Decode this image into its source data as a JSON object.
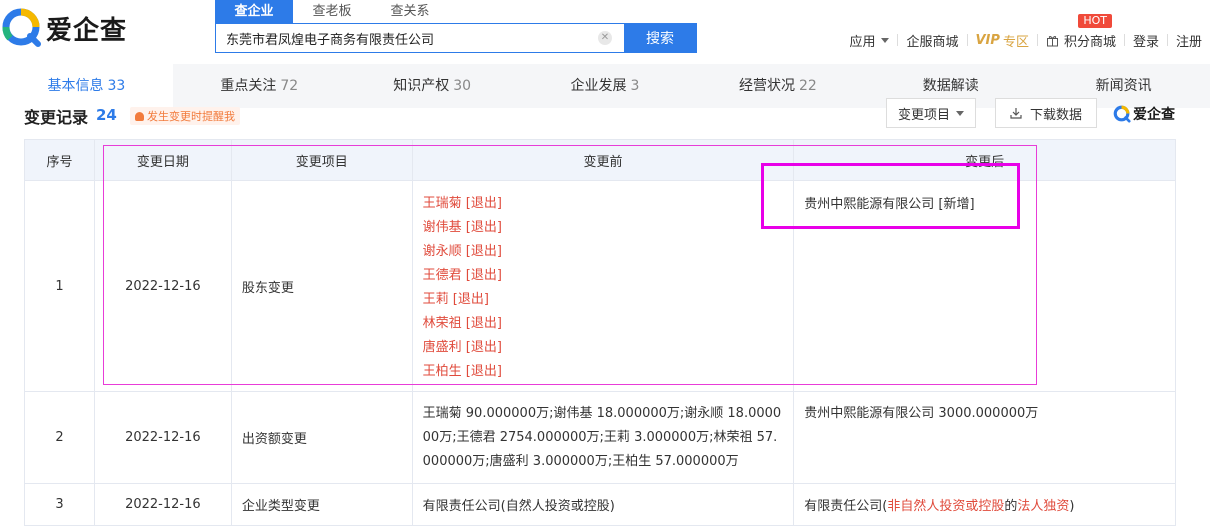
{
  "header": {
    "logo_text": "爱企查",
    "search_tabs": [
      "查企业",
      "查老板",
      "查关系"
    ],
    "search_value": "东莞市君凤煌电子商务有限责任公司",
    "search_button": "搜索",
    "nav": {
      "apps": "应用",
      "enterprise_mall": "企服商城",
      "vip_v": "VIP",
      "vip_rest": "专区",
      "points_mall": "积分商城",
      "hot_badge": "HOT",
      "login": "登录",
      "register": "注册"
    }
  },
  "tabs": [
    {
      "label": "基本信息",
      "count": "33"
    },
    {
      "label": "重点关注",
      "count": "72"
    },
    {
      "label": "知识产权",
      "count": "30"
    },
    {
      "label": "企业发展",
      "count": "3"
    },
    {
      "label": "经营状况",
      "count": "22"
    },
    {
      "label": "数据解读",
      "count": ""
    },
    {
      "label": "新闻资讯",
      "count": ""
    }
  ],
  "section": {
    "title": "变更记录",
    "count": "24",
    "remind": "发生变更时提醒我",
    "change_select": "变更项目",
    "download": "下载数据",
    "mini_logo": "爱企查"
  },
  "table": {
    "headers": [
      "序号",
      "变更日期",
      "变更项目",
      "变更前",
      "变更后"
    ],
    "rows": [
      {
        "idx": "1",
        "date": "2022-12-16",
        "item": "股东变更",
        "before": [
          "王瑞菊 [退出]",
          "谢伟基 [退出]",
          "谢永顺 [退出]",
          "王德君 [退出]",
          "王莉 [退出]",
          "林荣祖 [退出]",
          "唐盛利 [退出]",
          "王柏生 [退出]"
        ],
        "after": "贵州中熙能源有限公司 [新增]"
      },
      {
        "idx": "2",
        "date": "2022-12-16",
        "item": "出资额变更",
        "before": "王瑞菊 90.000000万;谢伟基 18.000000万;谢永顺 18.000000万;王德君 2754.000000万;王莉 3.000000万;林荣祖 57.000000万;唐盛利 3.000000万;王柏生 57.000000万",
        "after": "贵州中熙能源有限公司 3000.000000万"
      },
      {
        "idx": "3",
        "date": "2022-12-16",
        "item": "企业类型变更",
        "before": "有限责任公司(自然人投资或控股)",
        "after_prefix": "有限责任公司(",
        "after_red": "非自然人投资或控股",
        "after_mid": "的",
        "after_red2": "法人独资",
        "after_suffix": ")"
      }
    ]
  },
  "colors": {
    "accent": "#2d7be8",
    "red_text": "#e04b3c",
    "highlight": "#e800e8",
    "vip_gold": "#d9a441"
  }
}
